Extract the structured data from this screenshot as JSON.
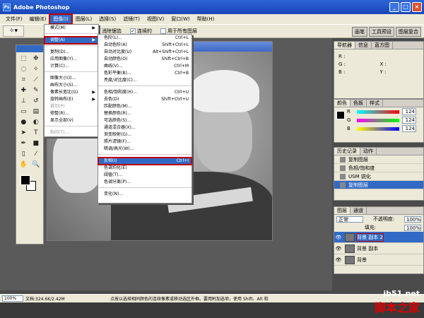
{
  "window": {
    "title": "Adobe Photoshop"
  },
  "menubar": [
    "文件(F)",
    "编辑(E)",
    "图像(I)",
    "图层(L)",
    "选择(S)",
    "滤镜(T)",
    "视图(V)",
    "窗口(W)",
    "帮助(H)"
  ],
  "options": {
    "antialias": "消除锯齿",
    "contiguous": "连续的",
    "all_layers": "用于所有图层"
  },
  "well_tabs": [
    "画笔",
    "工具预设",
    "图层复合"
  ],
  "image_menu": [
    {
      "label": "模式(M)",
      "sub": true
    },
    {
      "sep": true
    },
    {
      "label": "调整(A)",
      "sub": true,
      "highlight": true
    },
    {
      "sep": true
    },
    {
      "label": "复制(D)..."
    },
    {
      "label": "应用图像(Y)..."
    },
    {
      "label": "计算(C)..."
    },
    {
      "sep": true
    },
    {
      "label": "图像大小(I)..."
    },
    {
      "label": "画布大小(S)..."
    },
    {
      "label": "像素长宽比(G)",
      "sub": true
    },
    {
      "label": "旋转画布(E)",
      "sub": true
    },
    {
      "label": "裁切(P)",
      "dim": true
    },
    {
      "label": "修整(R)..."
    },
    {
      "label": "显示全部(V)"
    },
    {
      "sep": true
    },
    {
      "label": "陷印(T)...",
      "dim": true
    }
  ],
  "adjust_menu": [
    {
      "label": "色阶(L)...",
      "key": "Ctrl+L"
    },
    {
      "label": "自动色阶(A)",
      "key": "Shift+Ctrl+L"
    },
    {
      "label": "自动对比度(U)",
      "key": "Alt+Shift+Ctrl+L"
    },
    {
      "label": "自动颜色(O)",
      "key": "Shift+Ctrl+B"
    },
    {
      "label": "曲线(V)...",
      "key": "Ctrl+M"
    },
    {
      "label": "色彩平衡(B)...",
      "key": "Ctrl+B"
    },
    {
      "label": "亮度/对比度(C)...",
      "key": ""
    },
    {
      "sep": true
    },
    {
      "label": "色相/饱和度(H)...",
      "key": "Ctrl+U"
    },
    {
      "label": "去色(D)",
      "key": "Shift+Ctrl+U"
    },
    {
      "label": "匹配颜色(M)...",
      "key": ""
    },
    {
      "label": "替换颜色(R)...",
      "key": ""
    },
    {
      "label": "可选颜色(S)...",
      "key": ""
    },
    {
      "label": "通道混合器(X)...",
      "key": ""
    },
    {
      "label": "渐变映射(G)...",
      "key": ""
    },
    {
      "label": "照片滤镜(F)...",
      "key": ""
    },
    {
      "label": "暗调/高光(W)...",
      "key": ""
    },
    {
      "sep": true
    },
    {
      "label": "反相(I)",
      "key": "Ctrl+I",
      "highlight": true
    },
    {
      "label": "色调均化(E)",
      "key": ""
    },
    {
      "label": "阈值(T)...",
      "key": ""
    },
    {
      "label": "色调分离(P)...",
      "key": ""
    },
    {
      "sep": true
    },
    {
      "label": "变化(N)...",
      "key": ""
    }
  ],
  "nav_panel": {
    "tabs": [
      "导航器",
      "信息",
      "直方图"
    ],
    "r": "R :",
    "g": "G :",
    "b": "B :",
    "x": "X :",
    "y": "Y :"
  },
  "color_panel": {
    "tabs": [
      "颜色",
      "色板",
      "样式"
    ],
    "channels": [
      {
        "label": "R",
        "value": "124",
        "gradient": "linear-gradient(to right,#00ffff,#ff0000)"
      },
      {
        "label": "G",
        "value": "124",
        "gradient": "linear-gradient(to right,#ff00ff,#00ff00)"
      },
      {
        "label": "B",
        "value": "124",
        "gradient": "linear-gradient(to right,#ffff00,#0000ff)"
      }
    ]
  },
  "history_panel": {
    "tabs": [
      "历史记录",
      "动作"
    ],
    "items": [
      {
        "label": "复制图层",
        "selected": false
      },
      {
        "label": "色相/饱和度",
        "selected": false
      },
      {
        "label": "USM 锐化",
        "selected": false
      },
      {
        "label": "复制图层",
        "selected": true
      }
    ]
  },
  "layers_panel": {
    "tabs": [
      "图层",
      "通道"
    ],
    "blend": "正常",
    "opacity_label": "不透明度:",
    "opacity": "100%",
    "fill_label": "填充:",
    "fill": "100%",
    "layers": [
      {
        "name": "背景 副本 2",
        "selected": true
      },
      {
        "name": "背景 副本",
        "selected": false
      },
      {
        "name": "背景",
        "selected": false
      }
    ]
  },
  "status": {
    "zoom": "100%",
    "doc": "文档:324.6K/2.42M",
    "hint": "点按以选择相同颜色的连续像素或移动选区外框。要用附加选项，使用 Shift、Alt 和"
  },
  "watermark": {
    "url": "jb51.net",
    "name": "脚本之家"
  },
  "accent": "#316ac5",
  "highlight_border": "#c00000"
}
